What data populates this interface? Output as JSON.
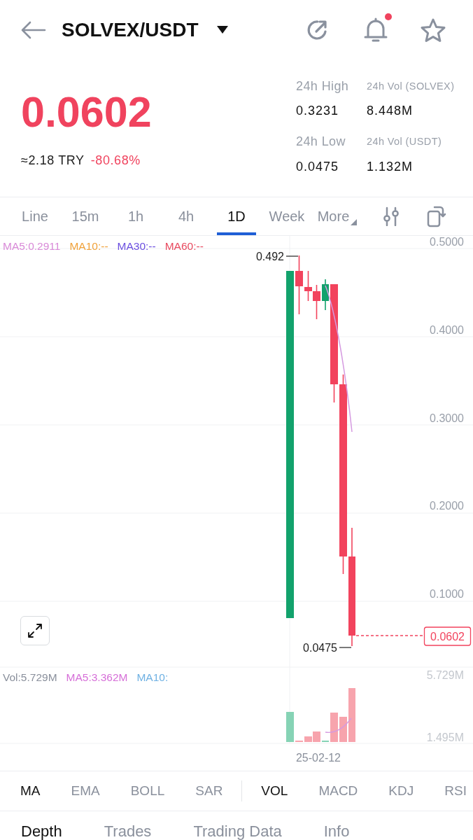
{
  "header": {
    "title": "SOLVEX/USDT",
    "bell_badge": true,
    "favorite": false
  },
  "ticker": {
    "price": "0.0602",
    "falling": true,
    "fiat": "≈2.18 TRY",
    "change": "-80.68%",
    "stats": [
      {
        "label": "24h High",
        "value": "0.3231"
      },
      {
        "label": "24h Vol (SOLVEX)",
        "value": "8.448M"
      },
      {
        "label": "24h Low",
        "value": "0.0475"
      },
      {
        "label": "24h Vol (USDT)",
        "value": "1.132M"
      }
    ]
  },
  "intervals": [
    {
      "label": "Line",
      "selected": false
    },
    {
      "label": "15m",
      "selected": false
    },
    {
      "label": "1h",
      "selected": false
    },
    {
      "label": "4h",
      "selected": false
    },
    {
      "label": "1D",
      "selected": true
    },
    {
      "label": "Week",
      "selected": false
    },
    {
      "label": "More",
      "selected": false
    }
  ],
  "chart": {
    "ma_legend": [
      {
        "text": "MA5:0.2911",
        "color": "#d98ad8"
      },
      {
        "text": "MA10:--",
        "color": "#f0a23a"
      },
      {
        "text": "MA30:--",
        "color": "#6b4fe0"
      },
      {
        "text": "MA60:--",
        "color": "#e84a5f"
      }
    ],
    "price_axis": [
      "0.5000",
      "0.4000",
      "0.3000",
      "0.2000",
      "0.1000"
    ],
    "high_label": "0.492",
    "low_label": "0.0475",
    "current_price": "0.0602",
    "candles": [
      {
        "kind": "rise"
      },
      {
        "kind": "fall"
      },
      {
        "kind": "fall"
      },
      {
        "kind": "fall"
      },
      {
        "kind": "rise"
      },
      {
        "kind": "fall"
      },
      {
        "kind": "fall"
      },
      {
        "kind": "fall"
      }
    ],
    "volume_legend": [
      {
        "text": "Vol:5.729M",
        "color": "#8a909c"
      },
      {
        "text": "MA5:3.362M",
        "color": "#d66fd8"
      },
      {
        "text": "MA10:",
        "color": "#6fb1e3"
      }
    ],
    "volume_axis": [
      "5.729M",
      "1.495M"
    ],
    "date_label": "25-02-12"
  },
  "indicators": {
    "main": [
      {
        "label": "MA",
        "selected": true
      },
      {
        "label": "EMA",
        "selected": false
      },
      {
        "label": "BOLL",
        "selected": false
      },
      {
        "label": "SAR",
        "selected": false
      }
    ],
    "sub": [
      {
        "label": "VOL",
        "selected": true
      },
      {
        "label": "MACD",
        "selected": false
      },
      {
        "label": "KDJ",
        "selected": false
      },
      {
        "label": "RSI",
        "selected": false
      }
    ]
  },
  "bottom_tabs": [
    {
      "label": "Depth",
      "selected": true
    },
    {
      "label": "Trades",
      "selected": false
    },
    {
      "label": "Trading Data",
      "selected": false
    },
    {
      "label": "Info",
      "selected": false
    }
  ]
}
